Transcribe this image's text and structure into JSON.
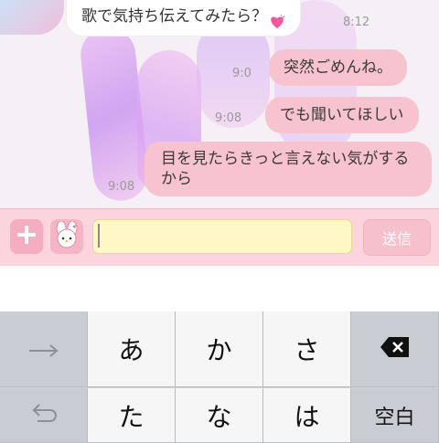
{
  "chat": {
    "messages": [
      {
        "id": "msg-0",
        "direction": "received",
        "text": "歌で気持ち伝えてみたら？",
        "icon": "heart-icon",
        "time": "8:12"
      },
      {
        "id": "msg-1",
        "direction": "sent",
        "text": "突然ごめんね。",
        "time": "9:0"
      },
      {
        "id": "msg-2",
        "direction": "sent",
        "text": "でも聞いてほしい",
        "time": "9:08"
      },
      {
        "id": "msg-3",
        "direction": "sent",
        "text": "目を見たらきっと言えない気がするから",
        "time": "9:08"
      }
    ]
  },
  "input_bar": {
    "plus_icon": "plus-icon",
    "sticker_icon": "melody-sticker-icon",
    "input_value": "",
    "send_label": "送信"
  },
  "keyboard": {
    "rows": [
      [
        {
          "label": "→",
          "icon": "next-arrow-icon",
          "type": "func"
        },
        {
          "label": "あ"
        },
        {
          "label": "か"
        },
        {
          "label": "さ"
        },
        {
          "label": "",
          "icon": "backspace-icon",
          "type": "func"
        }
      ],
      [
        {
          "label": "",
          "icon": "undo-icon",
          "type": "func"
        },
        {
          "label": "た"
        },
        {
          "label": "な"
        },
        {
          "label": "は"
        },
        {
          "label": "空白",
          "type": "space"
        }
      ]
    ]
  },
  "colors": {
    "sent_bubble": "#f6c3cf",
    "input_bar": "#fbd4de",
    "input_field": "#fff8c6",
    "keyboard_bg": "#ccd0d6"
  }
}
